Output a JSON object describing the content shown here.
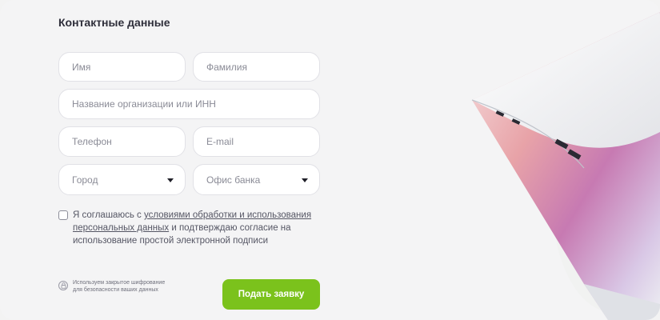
{
  "form": {
    "title": "Контактные данные",
    "first_name_placeholder": "Имя",
    "last_name_placeholder": "Фамилия",
    "org_placeholder": "Название организации или ИНН",
    "phone_placeholder": "Телефон",
    "email_placeholder": "E-mail",
    "city_label": "Город",
    "office_label": "Офис банка"
  },
  "consent": {
    "prefix": "Я соглашаюсь с ",
    "link": "условиями обработки и использования персональных данных",
    "suffix": " и подтверждаю согласие на использование простой электронной подписи"
  },
  "security": {
    "line1": "Используем закрытое шифрование",
    "line2": "для безопасности ваших данных",
    "icon": "lock-icon"
  },
  "submit_label": "Подать заявку",
  "colors": {
    "accent": "#7bc21c",
    "background": "#f4f4f5"
  }
}
